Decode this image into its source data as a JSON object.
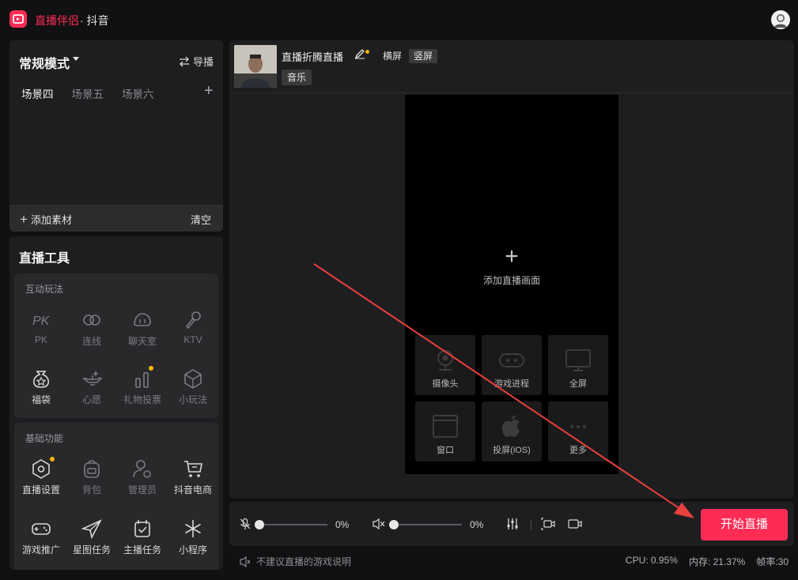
{
  "titlebar": {
    "app_name": "直播伴侣",
    "platform": "· 抖音"
  },
  "colors": {
    "brand": "#fe2c55",
    "badge": "#f2b705",
    "panel": "#1e1e20"
  },
  "scene": {
    "mode_label": "常规模式",
    "guide_label": "导播",
    "tabs": [
      "场景四",
      "场景五",
      "场景六"
    ],
    "active_tab": "场景四",
    "add_material_label": "添加素材",
    "clear_label": "清空"
  },
  "tools": {
    "title": "直播工具",
    "interactive": {
      "title": "互动玩法",
      "items": [
        "PK",
        "连线",
        "聊天室",
        "KTV",
        "福袋",
        "心愿",
        "礼物投票",
        "小玩法"
      ]
    },
    "basic": {
      "title": "基础功能",
      "items": [
        "直播设置",
        "背包",
        "管理员",
        "抖音电商",
        "游戏推广",
        "星图任务",
        "主播任务",
        "小程序"
      ]
    }
  },
  "preview": {
    "stream_title": "直播折腾直播",
    "orient_landscape": "横屏",
    "orient_portrait": "竖屏",
    "music_tag": "音乐",
    "add_screen_label": "添加直播画面",
    "sources": [
      "摄像头",
      "游戏进程",
      "全屏",
      "窗口",
      "投屏(iOS)",
      "更多"
    ]
  },
  "controls": {
    "mic_volume": "0%",
    "speaker_volume": "0%",
    "go_live_label": "开始直播"
  },
  "status": {
    "game_note": "不建议直播的游戏说明",
    "cpu": "CPU: 0.95%",
    "memory": "内存: 21.37%",
    "framerate": "帧率:30"
  }
}
